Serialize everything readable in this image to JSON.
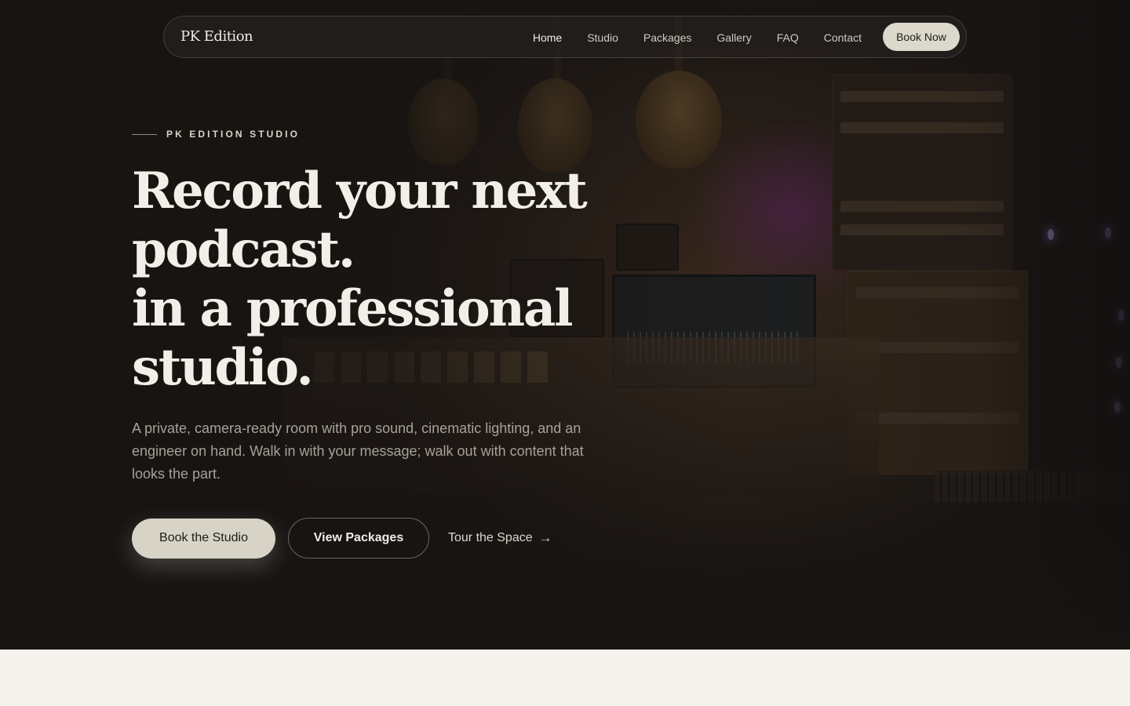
{
  "nav": {
    "brand": "PK Edition",
    "links": [
      "Home",
      "Studio",
      "Packages",
      "Gallery",
      "FAQ",
      "Contact"
    ],
    "cta": "Book Now"
  },
  "hero": {
    "eyebrow": "PK EDITION STUDIO",
    "headline": [
      "Record your next",
      "podcast.",
      "in a professional",
      "studio."
    ],
    "lede": "A private, camera-ready room with pro sound, cinematic lighting, and an engineer on hand. Walk in with your message; walk out with content that looks the part.",
    "primary_cta": "Book the Studio",
    "secondary_cta": "View Packages",
    "tertiary_cta": "Tour the Space",
    "tertiary_icon": "arrow-right-icon"
  },
  "colors": {
    "hero_bg": "#1a1614",
    "accent_button": "#d7d3c6",
    "page_bg": "#f4f3ee"
  }
}
